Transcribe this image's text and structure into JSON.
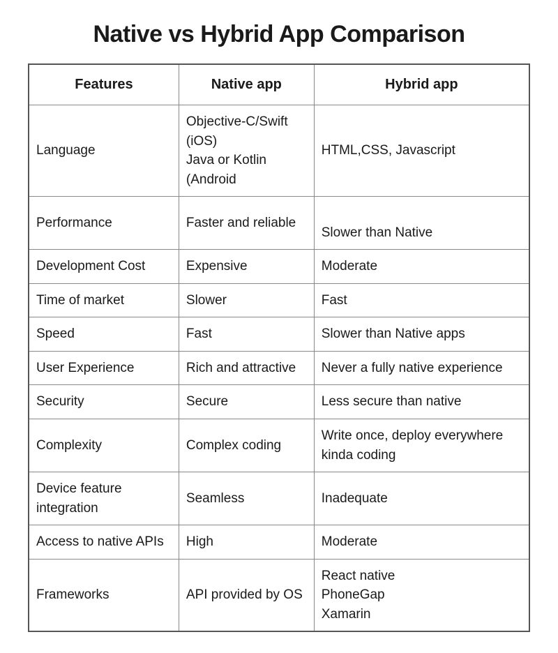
{
  "title": "Native vs Hybrid App Comparison",
  "headers": {
    "features": "Features",
    "native": "Native app",
    "hybrid": "Hybrid app"
  },
  "rows": [
    {
      "feature": "Language",
      "native": "Objective-C/Swift (iOS)\nJava or Kotlin (Android",
      "hybrid": "HTML,CSS, Javascript"
    },
    {
      "feature": "Performance",
      "native": "Faster and reliable",
      "hybrid": "\nSlower than Native"
    },
    {
      "feature": "Development Cost",
      "native": "Expensive",
      "hybrid": "Moderate"
    },
    {
      "feature": "Time of market",
      "native": "Slower",
      "hybrid": "Fast"
    },
    {
      "feature": "Speed",
      "native": "Fast",
      "hybrid": "Slower than Native apps"
    },
    {
      "feature": "User Experience",
      "native": "Rich and attractive",
      "hybrid": "Never a fully native experience"
    },
    {
      "feature": "Security",
      "native": "Secure",
      "hybrid": "Less secure than native"
    },
    {
      "feature": "Complexity",
      "native": "Complex coding",
      "hybrid": "Write once, deploy everywhere kinda coding"
    },
    {
      "feature": "Device feature integration",
      "native": "Seamless",
      "hybrid": "Inadequate"
    },
    {
      "feature": "Access to native APIs",
      "native": "High",
      "hybrid": "Moderate"
    },
    {
      "feature": "Frameworks",
      "native": "API provided by OS",
      "hybrid": "React native\nPhoneGap\nXamarin"
    }
  ],
  "chart_data": {
    "type": "table",
    "title": "Native vs Hybrid App Comparison",
    "columns": [
      "Features",
      "Native app",
      "Hybrid app"
    ],
    "rows": [
      [
        "Language",
        "Objective-C/Swift (iOS); Java or Kotlin (Android)",
        "HTML, CSS, Javascript"
      ],
      [
        "Performance",
        "Faster and reliable",
        "Slower than Native"
      ],
      [
        "Development Cost",
        "Expensive",
        "Moderate"
      ],
      [
        "Time of market",
        "Slower",
        "Fast"
      ],
      [
        "Speed",
        "Fast",
        "Slower than Native apps"
      ],
      [
        "User Experience",
        "Rich and attractive",
        "Never a fully native experience"
      ],
      [
        "Security",
        "Secure",
        "Less secure than native"
      ],
      [
        "Complexity",
        "Complex coding",
        "Write once, deploy everywhere kinda coding"
      ],
      [
        "Device feature integration",
        "Seamless",
        "Inadequate"
      ],
      [
        "Access to native APIs",
        "High",
        "Moderate"
      ],
      [
        "Frameworks",
        "API provided by OS",
        "React native; PhoneGap; Xamarin"
      ]
    ]
  }
}
